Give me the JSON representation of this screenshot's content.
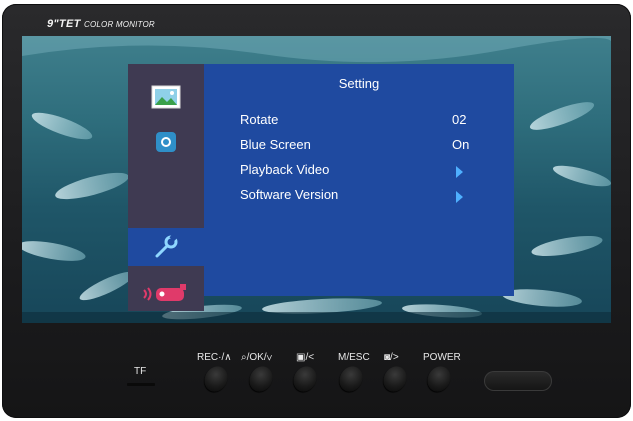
{
  "brand": {
    "main": "9\"TET",
    "sub": "COLOR MONITOR"
  },
  "osd": {
    "title": "Setting",
    "items": [
      {
        "label": "Rotate",
        "value": "02",
        "kind": "value"
      },
      {
        "label": "Blue Screen",
        "value": "On",
        "kind": "value"
      },
      {
        "label": "Playback Video",
        "value": "",
        "kind": "submenu",
        "arrow_icon": "triangle-right-icon"
      },
      {
        "label": "Software Version",
        "value": "",
        "kind": "submenu",
        "arrow_icon": "triangle-right-icon"
      }
    ],
    "side_icons": [
      "picture-icon",
      "camera-lens-icon",
      "wrench-icon",
      "recording-camera-icon"
    ],
    "active_side_icon": "wrench-icon",
    "colors": {
      "menu_bg": "#1f4aa0",
      "side_bg": "#3f3a52",
      "arrow": "#4fb0ff"
    }
  },
  "controls": {
    "tf_label": "TF",
    "buttons": [
      "REC·/∧",
      "⌕/OK/∨",
      "▣/<",
      "M/ESC",
      "◙/>",
      "POWER"
    ]
  }
}
